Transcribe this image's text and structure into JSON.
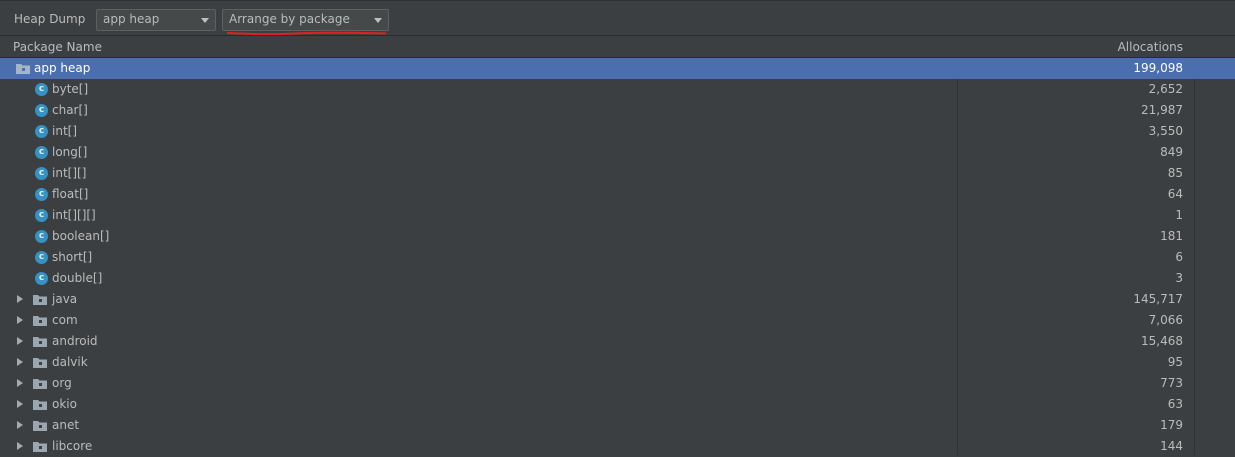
{
  "toolbar": {
    "label": "Heap Dump",
    "heap_select": "app heap",
    "arrange_select": "Arrange by package"
  },
  "table": {
    "columns": {
      "name": "Package Name",
      "allocations": "Allocations"
    },
    "root": {
      "name": "app heap",
      "count": "199,098"
    },
    "classes": [
      {
        "name": "byte[]",
        "count": "2,652"
      },
      {
        "name": "char[]",
        "count": "21,987"
      },
      {
        "name": "int[]",
        "count": "3,550"
      },
      {
        "name": "long[]",
        "count": "849"
      },
      {
        "name": "int[][]",
        "count": "85"
      },
      {
        "name": "float[]",
        "count": "64"
      },
      {
        "name": "int[][][]",
        "count": "1"
      },
      {
        "name": "boolean[]",
        "count": "181"
      },
      {
        "name": "short[]",
        "count": "6"
      },
      {
        "name": "double[]",
        "count": "3"
      }
    ],
    "packages": [
      {
        "name": "java",
        "count": "145,717"
      },
      {
        "name": "com",
        "count": "7,066"
      },
      {
        "name": "android",
        "count": "15,468"
      },
      {
        "name": "dalvik",
        "count": "95"
      },
      {
        "name": "org",
        "count": "773"
      },
      {
        "name": "okio",
        "count": "63"
      },
      {
        "name": "anet",
        "count": "179"
      },
      {
        "name": "libcore",
        "count": "144"
      }
    ]
  },
  "icons": {
    "class_letter": "c"
  },
  "colors": {
    "background": "#3c3f41",
    "selection": "#4b6eaf",
    "class_icon": "#3592c4",
    "annotation_underline": "#e02020"
  }
}
